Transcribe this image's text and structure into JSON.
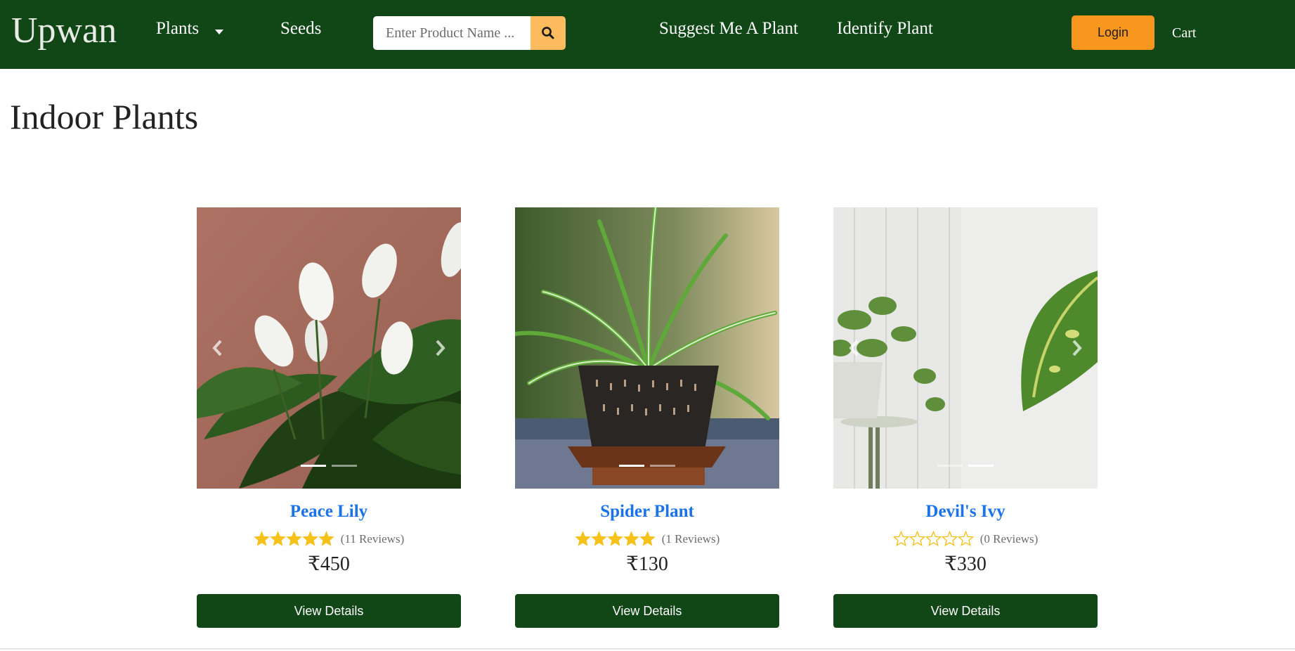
{
  "navbar": {
    "brand": "Upwan",
    "plants_label": "Plants",
    "seeds_label": "Seeds",
    "search_placeholder": "Enter Product Name ...",
    "suggest_label": "Suggest Me A Plant",
    "identify_label": "Identify Plant",
    "login_label": "Login",
    "cart_label": "Cart"
  },
  "page": {
    "title": "Indoor Plants"
  },
  "products": [
    {
      "name": "Peace Lily",
      "rating": 5,
      "reviews": "(11 Reviews)",
      "price": "₹450",
      "button": "View Details",
      "active_slide": 0,
      "slides": 2
    },
    {
      "name": "Spider Plant",
      "rating": 5,
      "reviews": "(1 Reviews)",
      "price": "₹130",
      "button": "View Details",
      "active_slide": 0,
      "slides": 2
    },
    {
      "name": "Devil's Ivy",
      "rating": 0,
      "reviews": "(0 Reviews)",
      "price": "₹330",
      "button": "View Details",
      "active_slide": 1,
      "slides": 2
    }
  ],
  "colors": {
    "navbar_bg": "#114717",
    "search_button": "#fdbb5f",
    "login_button": "#f7971e",
    "product_name": "#1a73e8",
    "star_filled": "#f6c21a",
    "view_button": "#114717"
  },
  "icons": {
    "search": "search-icon",
    "dropdown": "caret-down-icon",
    "carousel_prev": "chevron-left-icon",
    "carousel_next": "chevron-right-icon",
    "star": "star-icon"
  }
}
